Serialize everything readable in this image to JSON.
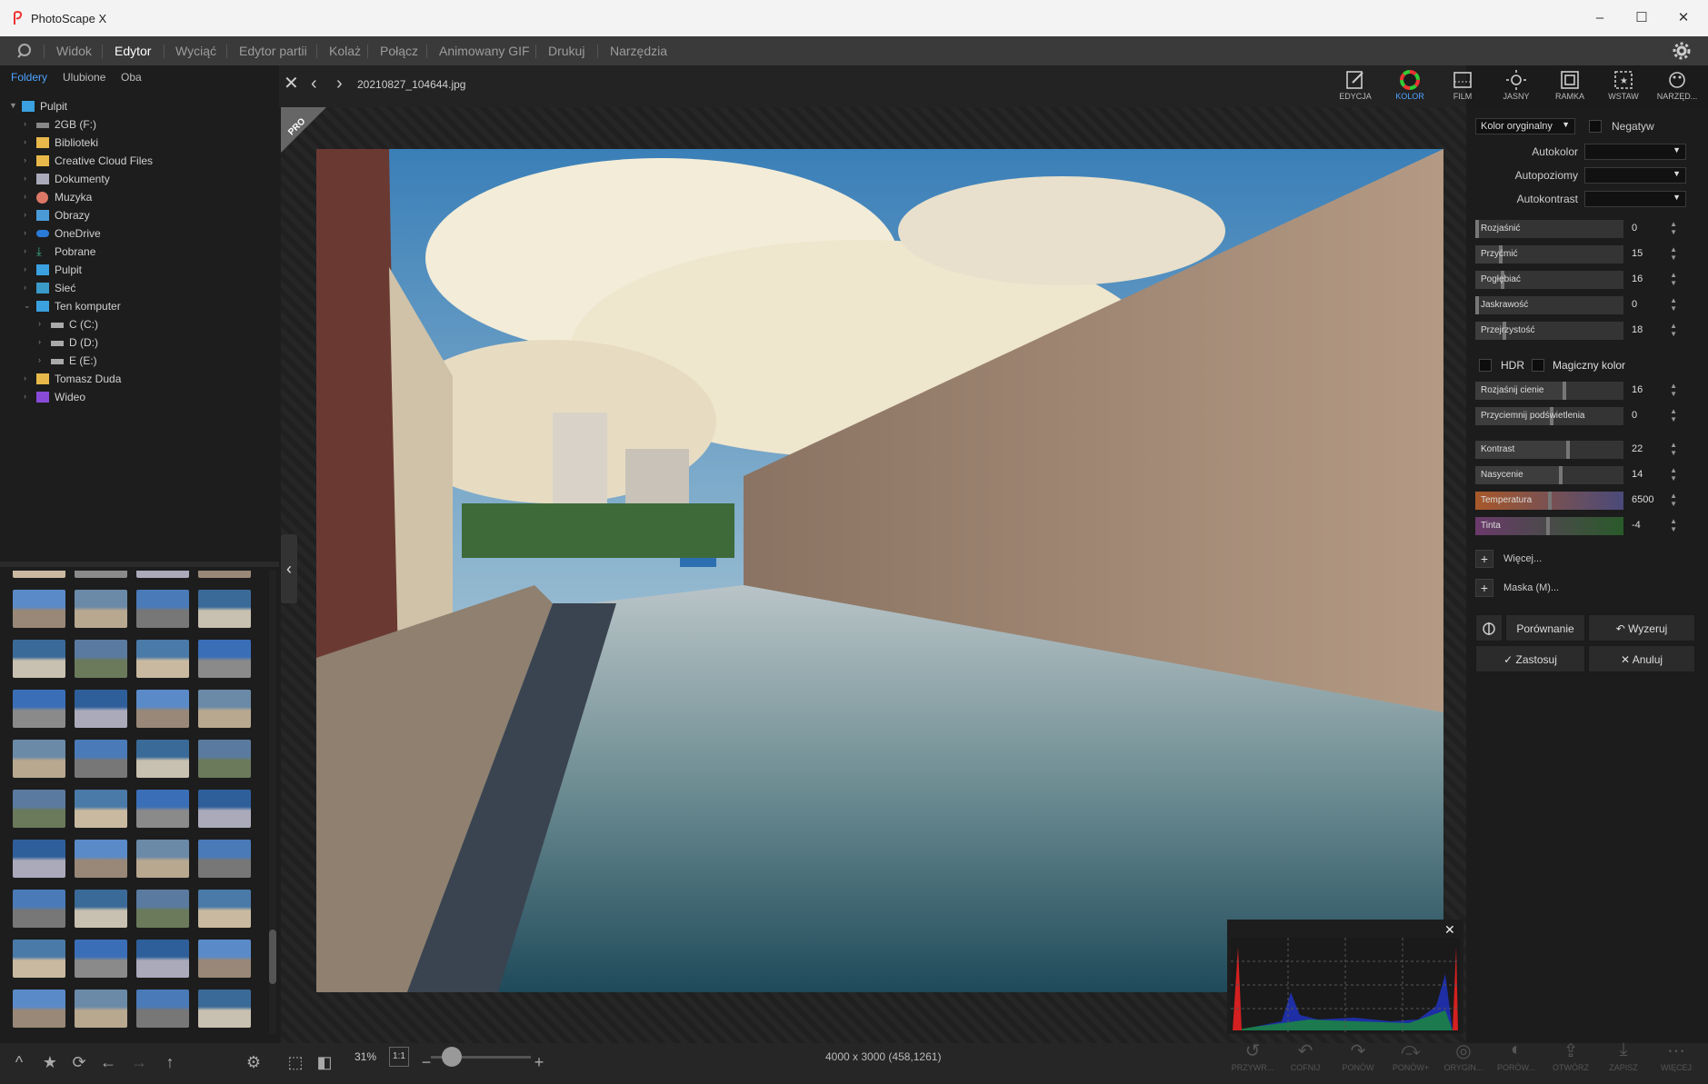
{
  "window": {
    "title": "PhotoScape X",
    "controls": [
      "minimize-icon",
      "maximize-icon",
      "close-icon"
    ]
  },
  "menu": {
    "items": [
      "Widok",
      "Edytor",
      "Wyciąć",
      "Edytor partii",
      "Kolaż",
      "Połącz",
      "Animowany GIF",
      "Drukuj",
      "Narzędzia"
    ],
    "active": "Edytor"
  },
  "sidebar": {
    "tabs": [
      "Foldery",
      "Ulubione",
      "Oba"
    ],
    "tree": [
      {
        "label": "Pulpit",
        "level": 0,
        "expanded": true
      },
      {
        "label": "2GB (F:)",
        "level": 1
      },
      {
        "label": "Biblioteki",
        "level": 1
      },
      {
        "label": "Creative Cloud Files",
        "level": 1
      },
      {
        "label": "Dokumenty",
        "level": 1
      },
      {
        "label": "Muzyka",
        "level": 1
      },
      {
        "label": "Obrazy",
        "level": 1
      },
      {
        "label": "OneDrive",
        "level": 1
      },
      {
        "label": "Pobrane",
        "level": 1
      },
      {
        "label": "Pulpit",
        "level": 1
      },
      {
        "label": "Sieć",
        "level": 1
      },
      {
        "label": "Ten komputer",
        "level": 1,
        "expanded": true
      },
      {
        "label": "C (C:)",
        "level": 2
      },
      {
        "label": "D (D:)",
        "level": 2
      },
      {
        "label": "E (E:)",
        "level": 2
      },
      {
        "label": "Tomasz Duda",
        "level": 1
      },
      {
        "label": "Wideo",
        "level": 1
      }
    ]
  },
  "viewer": {
    "filename": "20210827_104644.jpg",
    "badge": "PRO"
  },
  "tools": [
    {
      "label": "EDYCJA",
      "icon": "edit-icon"
    },
    {
      "label": "KOLOR",
      "icon": "color-wheel-icon",
      "active": true
    },
    {
      "label": "FILM",
      "icon": "film-icon"
    },
    {
      "label": "JASNY",
      "icon": "sun-icon"
    },
    {
      "label": "RAMKA",
      "icon": "frame-icon"
    },
    {
      "label": "WSTAW",
      "icon": "insert-icon"
    },
    {
      "label": "NARZĘD...",
      "icon": "tools-icon"
    }
  ],
  "color_panel": {
    "preset": "Kolor oryginalny",
    "negative": "Negatyw",
    "auto": [
      "Autokolor",
      "Autopoziomy",
      "Autokontrast"
    ],
    "sliders1": [
      {
        "label": "Rozjaśnić",
        "value": "0"
      },
      {
        "label": "Przyćmić",
        "value": "15"
      },
      {
        "label": "Pogłębiać",
        "value": "16"
      },
      {
        "label": "Jaskrawość",
        "value": "0"
      },
      {
        "label": "Przejrzystość",
        "value": "18"
      }
    ],
    "hdr": "HDR",
    "magic": "Magiczny kolor",
    "sliders2": [
      {
        "label": "Rozjaśnij cienie",
        "value": "16"
      },
      {
        "label": "Przyciemnij podświetlenia",
        "value": "0"
      }
    ],
    "sliders3": [
      {
        "label": "Kontrast",
        "value": "22"
      },
      {
        "label": "Nasycenie",
        "value": "14"
      },
      {
        "label": "Temperatura",
        "value": "6500"
      },
      {
        "label": "Tinta",
        "value": "-4"
      }
    ],
    "more": "Więcej...",
    "mask": "Maska (M)...",
    "compare": "Porównanie",
    "reset": "Wyzeruj",
    "apply": "Zastosuj",
    "cancel": "Anuluj"
  },
  "status": {
    "zoom": "31%",
    "one_to_one": "1:1",
    "info": "4000 x 3000 (458,1261)"
  },
  "bottom_actions": [
    "PRZYWR...",
    "COFNIJ",
    "PONÓW",
    "PONÓW+",
    "ORYGIN...",
    "PORÓW...",
    "OTWÓRZ",
    "ZAPISZ",
    "WIĘCEJ"
  ]
}
